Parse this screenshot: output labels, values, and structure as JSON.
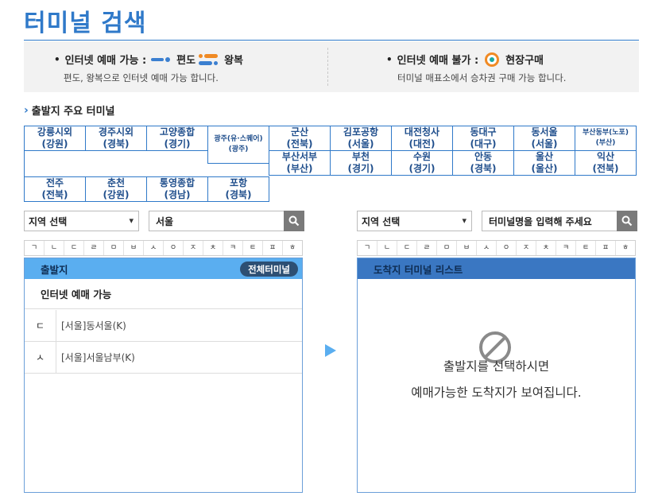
{
  "page": {
    "title": "터미널 검색"
  },
  "info": {
    "online": {
      "label": "인터넷 예매 가능 :",
      "oneway_label": "편도",
      "roundtrip_label": "왕복",
      "desc": "편도, 왕복으로 인터넷 예매 가능 합니다."
    },
    "offline": {
      "label": "인터넷 예매 불가 :",
      "onsite_label": "현장구매",
      "desc": "터미널 매표소에서 승차권 구매 가능 합니다."
    }
  },
  "major": {
    "heading": "출발지 주요 터미널",
    "terminals": [
      "강릉시외\n(강원)",
      "경주시외\n(경북)",
      "고양종합\n(경기)",
      "광주(유·스퀘어)\n(광주)",
      "군산\n(전북)",
      "김포공항\n(서울)",
      "대전청사\n(대전)",
      "동대구\n(대구)",
      "동서울\n(서울)",
      "부산동부(노포)\n(부산)",
      "부산서부\n(부산)",
      "부천\n(경기)",
      "수원\n(경기)",
      "안동\n(경북)",
      "울산\n(울산)",
      "익산\n(전북)",
      "전주\n(전북)",
      "춘천\n(강원)",
      "통영종합\n(경남)",
      "포항\n(경북)"
    ]
  },
  "departure": {
    "region_select": "지역 선택",
    "search_value": "서울",
    "consonants": [
      "ㄱ",
      "ㄴ",
      "ㄷ",
      "ㄹ",
      "ㅁ",
      "ㅂ",
      "ㅅ",
      "ㅇ",
      "ㅈ",
      "ㅊ",
      "ㅋ",
      "ㅌ",
      "ㅍ",
      "ㅎ"
    ],
    "panel_title": "출발지",
    "all_button": "전체터미널",
    "subhead": "인터넷 예매 가능",
    "rows": [
      {
        "idx": "ㄷ",
        "name": "[서울]동서울(K)"
      },
      {
        "idx": "ㅅ",
        "name": "[서울]서울남부(K)"
      }
    ]
  },
  "arrival": {
    "region_select": "지역 선택",
    "search_placeholder": "터미널명을 입력해 주세요",
    "consonants": [
      "ㄱ",
      "ㄴ",
      "ㄷ",
      "ㄹ",
      "ㅁ",
      "ㅂ",
      "ㅅ",
      "ㅇ",
      "ㅈ",
      "ㅊ",
      "ㅋ",
      "ㅌ",
      "ㅍ",
      "ㅎ"
    ],
    "panel_title": "도착지 터미널 리스트",
    "empty_line1": "출발지를 선택하시면",
    "empty_line2": "예매가능한 도착지가 보여집니다."
  }
}
